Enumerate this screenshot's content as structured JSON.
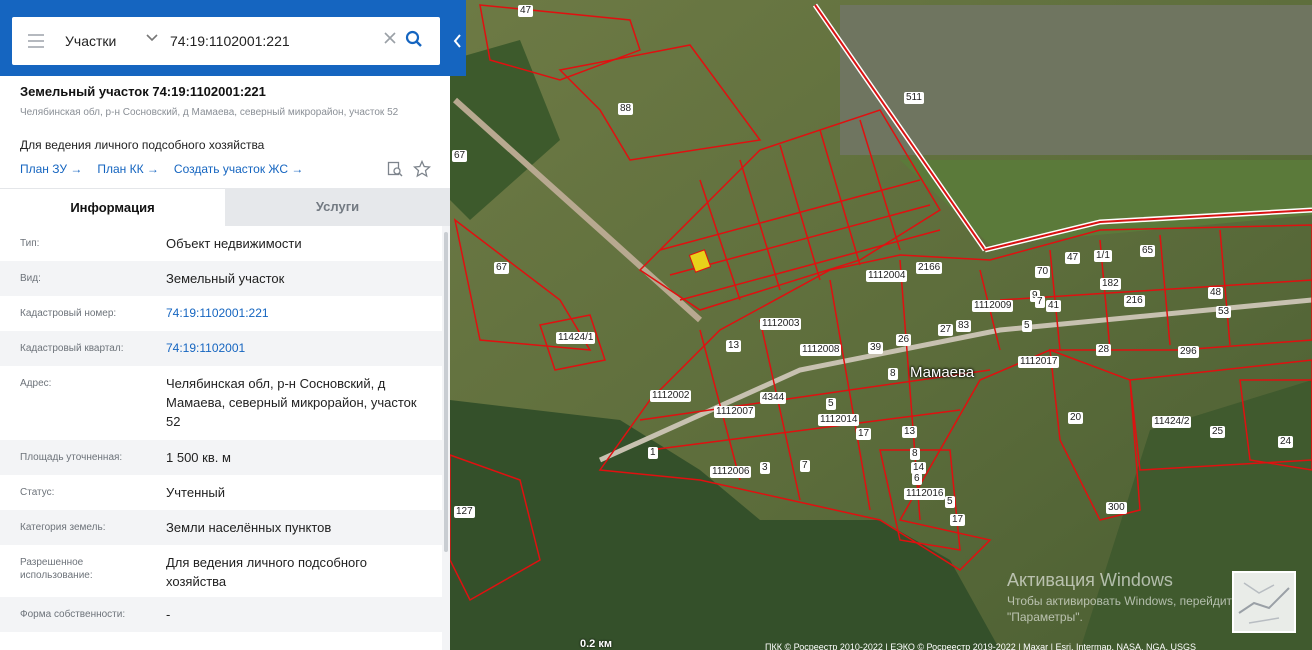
{
  "search": {
    "type_select": "Участки",
    "query": "74:19:1102001:221"
  },
  "object": {
    "title": "Земельный участок 74:19:1102001:221",
    "address_short": "Челябинская обл, р-н Сосновский, д Мамаева, северный микрорайон, участок 52",
    "usage": "Для ведения личного подсобного хозяйства",
    "links": [
      "План ЗУ →",
      "План КК →",
      "Создать участок ЖС →"
    ]
  },
  "tabs": [
    "Информация",
    "Услуги"
  ],
  "info_rows": [
    {
      "label": "Тип:",
      "value": "Объект недвижимости",
      "link": false
    },
    {
      "label": "Вид:",
      "value": "Земельный участок",
      "link": false
    },
    {
      "label": "Кадастровый номер:",
      "value": "74:19:1102001:221",
      "link": true
    },
    {
      "label": "Кадастровый квартал:",
      "value": "74:19:1102001",
      "link": true
    },
    {
      "label": "Адрес:",
      "value": "Челябинская обл, р-н Сосновский, д Мамаева, северный микрорайон, участок 52",
      "link": false
    },
    {
      "label": "Площадь уточненная:",
      "value": "1 500 кв. м",
      "link": false
    },
    {
      "label": "Статус:",
      "value": "Учтенный",
      "link": false
    },
    {
      "label": "Категория земель:",
      "value": "Земли населённых пунктов",
      "link": false
    },
    {
      "label": "Разрешенное использование:",
      "value": "Для ведения личного подсобного хозяйства",
      "link": false
    },
    {
      "label": "Форма собственности:",
      "value": "-",
      "link": false
    }
  ],
  "map": {
    "village_name": "Мамаева",
    "parcel_labels": [
      "47",
      "88",
      "511",
      "67",
      "67",
      "11424/1",
      "1112004",
      "2166",
      "1112009",
      "70",
      "47",
      "9",
      "1/1",
      "182",
      "216",
      "65",
      "48",
      "53",
      "1112003",
      "1112008",
      "39",
      "26",
      "27",
      "83",
      "5",
      "1112017",
      "28",
      "296",
      "13",
      "7",
      "41",
      "1112002",
      "4344",
      "1112007",
      "5",
      "1112014",
      "17",
      "13",
      "8",
      "14",
      "6",
      "1112006",
      "3",
      "7",
      "1",
      "20",
      "11424/2",
      "25",
      "24",
      "1112016",
      "5",
      "17",
      "300",
      "127",
      "8"
    ],
    "scale": "0.2 км",
    "attribution": "ПКК © Росреестр 2010-2022 | ЕЭКО © Росреестр 2019-2022 | Maxar | Esri, Intermap, NASA, NGA, USGS",
    "activation_title": "Активация Windows",
    "activation_text": "Чтобы активировать Windows, перейдите в раздел \"Параметры\"."
  },
  "colors": {
    "accent": "#1565c0",
    "parcel_border": "#e01010",
    "selected_parcel": "#e8d21a"
  }
}
